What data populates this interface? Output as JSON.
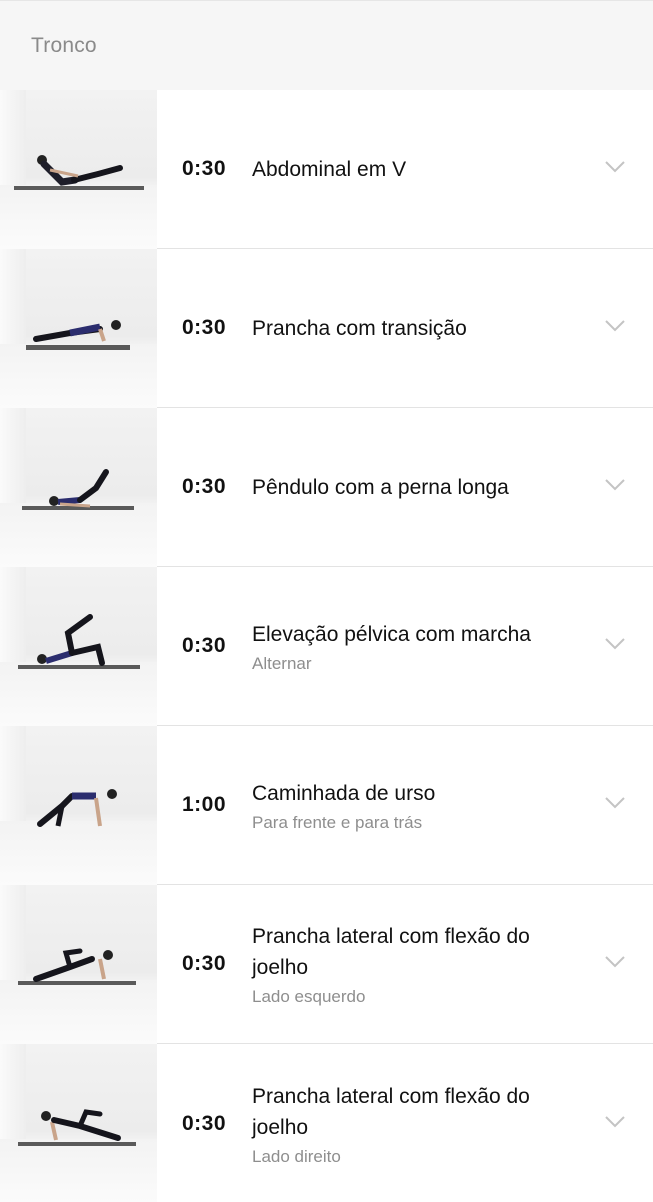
{
  "section": {
    "title": "Tronco"
  },
  "exercises": [
    {
      "duration": "0:30",
      "name": "Abdominal em V",
      "sub": ""
    },
    {
      "duration": "0:30",
      "name": "Prancha com transição",
      "sub": ""
    },
    {
      "duration": "0:30",
      "name": "Pêndulo com a perna longa",
      "sub": ""
    },
    {
      "duration": "0:30",
      "name": "Elevação pélvica com marcha",
      "sub": "Alternar"
    },
    {
      "duration": "1:00",
      "name": "Caminhada de urso",
      "sub": "Para frente e para trás"
    },
    {
      "duration": "0:30",
      "name": "Prancha lateral com flexão do joelho",
      "sub": "Lado esquerdo"
    },
    {
      "duration": "0:30",
      "name": "Prancha lateral com flexão do joelho",
      "sub": "Lado direito"
    }
  ],
  "icons": {
    "expand": "chevron-down-icon"
  },
  "colors": {
    "header_bg": "#f6f6f6",
    "divider": "#e3e3e3",
    "sub_text": "#8e8e8e"
  }
}
